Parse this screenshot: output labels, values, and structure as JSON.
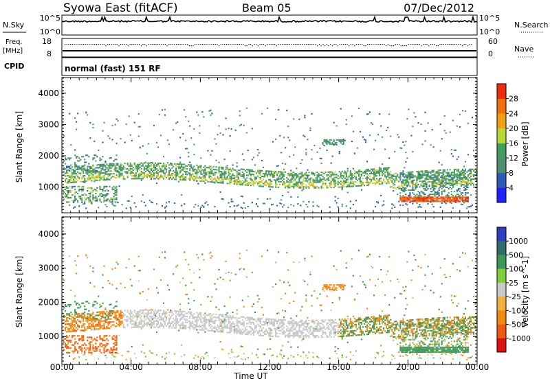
{
  "header": {
    "title": "Syowa East (fitACF)",
    "beam": "Beam 05",
    "date": "07/Dec/2012"
  },
  "noise_panel": {
    "left_label": "N.Sky",
    "left_ticks": [
      "10^5",
      "10^0"
    ],
    "right_label": "N.Search",
    "right_ticks": [
      "10^5",
      "10^0"
    ]
  },
  "freq_panel": {
    "left_label_line1": "Freq.",
    "left_label_line2": "[MHz]",
    "left_ticks": [
      "18",
      "8"
    ],
    "right_label": "Nave",
    "right_ticks": [
      "60",
      "0"
    ]
  },
  "cpid": {
    "label": "CPID",
    "mode": "normal (fast) 151 RF"
  },
  "colors": {
    "power_scale": [
      "#1f1fff",
      "#2f5bb5",
      "#4f8f6f",
      "#3f9f5f",
      "#b8d83a",
      "#f0a010",
      "#f07010",
      "#ef2a10"
    ],
    "velocity_scale": [
      "#2d3fbf",
      "#2f6e6a",
      "#3c9a57",
      "#7fcf3a",
      "#c8c8c8",
      "#f0b040",
      "#f08a10",
      "#ee5a10",
      "#e21010"
    ]
  },
  "chart_data": [
    {
      "type": "heatmap",
      "name": "power",
      "x_ticks": [
        "00:00",
        "04:00",
        "08:00",
        "12:00",
        "16:00",
        "20:00",
        "00:00"
      ],
      "xlabel": "Time UT",
      "ylabel": "Slant Range [km]",
      "ylim": [
        180,
        4500
      ],
      "y_ticks": [
        1000,
        2000,
        3000,
        4000
      ],
      "colorbar": {
        "label": "Power [dB]",
        "ticks": [
          4,
          8,
          12,
          16,
          20,
          24,
          28
        ]
      },
      "features": [
        {
          "t_start": 0.0,
          "t_end": 24.0,
          "range_km": 1450,
          "power_db": 10
        },
        {
          "t_start": 0.0,
          "t_end": 24.0,
          "range_km": 1250,
          "power_db": 16
        },
        {
          "t_start": 19.5,
          "t_end": 23.5,
          "range_km": 560,
          "power_db": 28
        },
        {
          "t_start": 15.0,
          "t_end": 16.2,
          "range_km": 2450,
          "power_db": 12
        }
      ]
    },
    {
      "type": "heatmap",
      "name": "velocity",
      "x_ticks": [
        "00:00",
        "04:00",
        "08:00",
        "12:00",
        "16:00",
        "20:00",
        "00:00"
      ],
      "xlabel": "Time UT",
      "ylabel": "Slant Range [km]",
      "ylim": [
        180,
        4500
      ],
      "y_ticks": [
        1000,
        2000,
        3000,
        4000
      ],
      "colorbar": {
        "label": "Velocity [m s^-1]",
        "ticks": [
          1000,
          500,
          100,
          25,
          -25,
          -100,
          -500,
          -1000
        ]
      },
      "features": [
        {
          "t_start": 4.0,
          "t_end": 16.0,
          "range_km": 1400,
          "velocity": 0
        },
        {
          "t_start": 0.0,
          "t_end": 3.0,
          "range_km": 800,
          "velocity": -500
        },
        {
          "t_start": 19.5,
          "t_end": 23.5,
          "range_km": 580,
          "velocity": 250
        },
        {
          "t_start": 15.0,
          "t_end": 16.2,
          "range_km": 2400,
          "velocity": -150
        }
      ]
    }
  ]
}
